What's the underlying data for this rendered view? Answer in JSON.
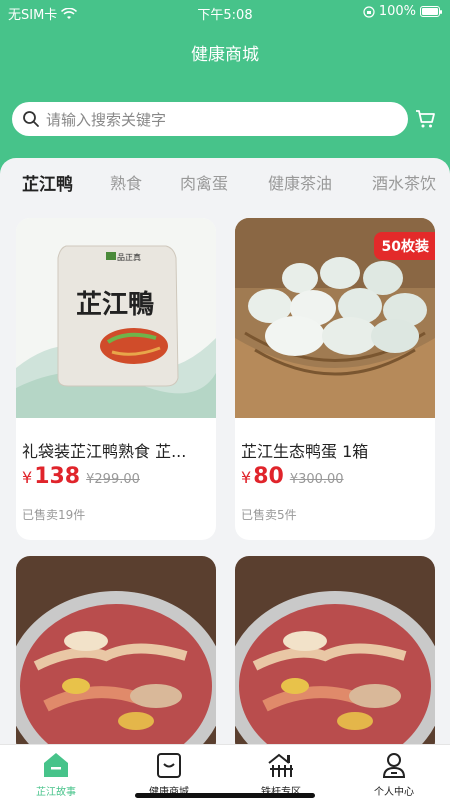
{
  "status": {
    "carrier": "无SIM卡",
    "time": "下午5:08",
    "battery": "100%"
  },
  "header": {
    "title": "健康商城"
  },
  "search": {
    "placeholder": "请输入搜索关键字"
  },
  "tabs": [
    {
      "label": "芷江鸭",
      "active": true
    },
    {
      "label": "熟食"
    },
    {
      "label": "肉禽蛋"
    },
    {
      "label": "健康茶油"
    },
    {
      "label": "酒水茶饮"
    }
  ],
  "products": [
    {
      "name": "礼袋装芷江鸭熟食 芷...",
      "currency": "¥",
      "price": "138",
      "original": "¥299.00",
      "sold": "已售卖19件",
      "package_brand": "品正真",
      "package_title": "芷江鴨"
    },
    {
      "name": "芷江生态鸭蛋 1箱",
      "currency": "¥",
      "price": "80",
      "original": "¥300.00",
      "sold": "已售卖5件",
      "badge": "50枚装"
    },
    {
      "name": ""
    },
    {
      "name": ""
    }
  ],
  "nav": [
    {
      "label": "芷江故事",
      "icon": "home-icon",
      "active": true
    },
    {
      "label": "健康商城",
      "icon": "shop-bag-icon"
    },
    {
      "label": "铁杆专区",
      "icon": "house-fence-icon"
    },
    {
      "label": "个人中心",
      "icon": "user-icon"
    }
  ],
  "colors": {
    "primary": "#47c38a",
    "price": "#e0242b",
    "badge": "#e32a2a"
  }
}
